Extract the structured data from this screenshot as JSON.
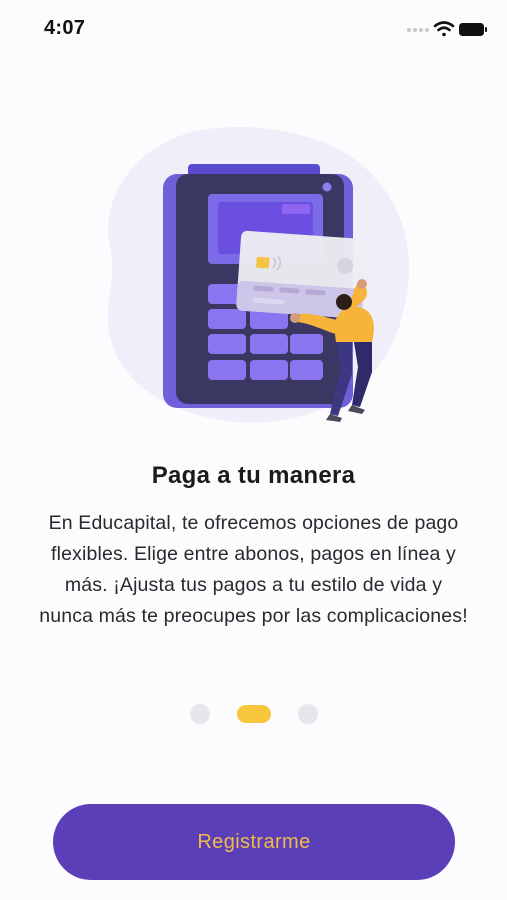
{
  "status_bar": {
    "time": "4:07",
    "icons": [
      "signal-icon",
      "wifi-icon",
      "battery-icon"
    ]
  },
  "illustration": {
    "name": "card-payment-terminal-illustration"
  },
  "onboarding": {
    "title": "Paga a tu manera",
    "description": "En Educapital, te ofrecemos opciones de pago flexibles. Elige entre abonos, pagos en línea y más. ¡Ajusta tus pagos a tu estilo de vida y nunca más te preocupes por las complicaciones!",
    "page_count": 3,
    "current_page": 2
  },
  "actions": {
    "register_label": "Registrarme"
  },
  "colors": {
    "primary": "#5a3fb9",
    "accent": "#f7c63c",
    "button_text": "#f2b94a",
    "inactive_dot": "#e7e6ea",
    "background": "#fcfbfd"
  }
}
